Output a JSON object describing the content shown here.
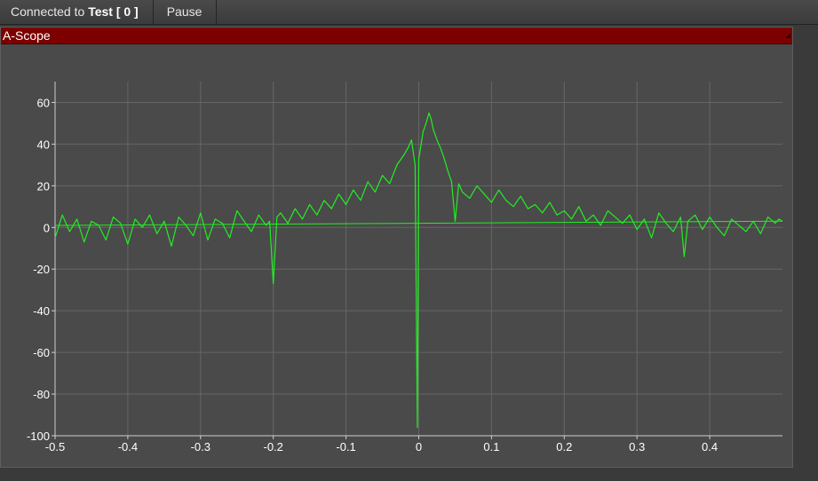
{
  "toolbar": {
    "connection_prefix": "Connected to",
    "connection_name": "Test [ 0 ]",
    "pause_label": "Pause"
  },
  "panel": {
    "title": "A-Scope"
  },
  "colors": {
    "trace": "#22ee22",
    "title_bar": "#7d0000",
    "plot_bg": "#4a4a4a",
    "grid": "#666666",
    "axis": "#cfcfcf"
  },
  "chart_data": {
    "type": "line",
    "title": "",
    "xlabel": "",
    "ylabel": "",
    "xlim": [
      -0.5,
      0.5
    ],
    "ylim": [
      -100,
      70
    ],
    "grid": true,
    "xticks": [
      -0.5,
      -0.4,
      -0.3,
      -0.2,
      -0.1,
      0,
      0.1,
      0.2,
      0.3,
      0.4
    ],
    "xtick_labels": [
      "-0.5",
      "-0.4",
      "-0.3",
      "-0.2",
      "-0.1",
      "0",
      "0.1",
      "0.2",
      "0.3",
      "0.4"
    ],
    "yticks": [
      60,
      40,
      20,
      0,
      -20,
      -40,
      -60,
      -80,
      -100
    ],
    "ytick_labels": [
      "60",
      "40",
      "20",
      "0",
      "-20",
      "-40",
      "-60",
      "-80",
      "-100"
    ],
    "series": [
      {
        "x": [
          -0.5,
          -0.49,
          -0.48,
          -0.47,
          -0.46,
          -0.45,
          -0.44,
          -0.43,
          -0.42,
          -0.41,
          -0.4,
          -0.39,
          -0.38,
          -0.37,
          -0.36,
          -0.35,
          -0.34,
          -0.33,
          -0.32,
          -0.31,
          -0.3,
          -0.29,
          -0.28,
          -0.27,
          -0.26,
          -0.25,
          -0.24,
          -0.23,
          -0.22,
          -0.21,
          -0.205,
          -0.2,
          -0.195,
          -0.19,
          -0.18,
          -0.17,
          -0.16,
          -0.15,
          -0.14,
          -0.13,
          -0.12,
          -0.11,
          -0.1,
          -0.09,
          -0.08,
          -0.07,
          -0.06,
          -0.05,
          -0.04,
          -0.03,
          -0.02,
          -0.015,
          -0.01,
          -0.005,
          -0.002,
          0,
          0.002,
          0.006,
          0.01,
          0.014,
          0.017,
          0.02,
          0.025,
          0.03,
          0.035,
          0.04,
          0.045,
          0.05,
          0.055,
          0.06,
          0.07,
          0.08,
          0.09,
          0.1,
          0.11,
          0.12,
          0.13,
          0.14,
          0.15,
          0.16,
          0.17,
          0.18,
          0.19,
          0.2,
          0.21,
          0.22,
          0.23,
          0.24,
          0.25,
          0.26,
          0.27,
          0.28,
          0.29,
          0.3,
          0.31,
          0.32,
          0.33,
          0.34,
          0.35,
          0.36,
          0.365,
          0.37,
          0.38,
          0.39,
          0.4,
          0.41,
          0.42,
          0.43,
          0.44,
          0.45,
          0.46,
          0.47,
          0.48,
          0.49,
          0.495,
          0.5
        ],
        "y": [
          -5,
          6,
          -2,
          4,
          -7,
          3,
          1,
          -6,
          5,
          2,
          -8,
          4,
          0,
          6,
          -3,
          3,
          -9,
          5,
          1,
          -4,
          7,
          -6,
          4,
          2,
          -5,
          8,
          3,
          -2,
          6,
          1,
          3,
          -27,
          5,
          7,
          2,
          9,
          4,
          11,
          6,
          13,
          9,
          16,
          11,
          18,
          13,
          22,
          17,
          25,
          21,
          30,
          35,
          38,
          42,
          30,
          -96,
          33,
          37,
          46,
          50,
          55,
          52,
          47,
          42,
          38,
          33,
          27,
          22,
          3,
          21,
          17,
          14,
          20,
          16,
          12,
          18,
          13,
          10,
          15,
          9,
          11,
          7,
          12,
          6,
          8,
          4,
          10,
          3,
          6,
          1,
          8,
          5,
          2,
          6,
          -1,
          4,
          -5,
          7,
          2,
          -2,
          5,
          -14,
          3,
          6,
          -1,
          5,
          0,
          -4,
          4,
          1,
          -2,
          3,
          -3,
          5,
          2,
          4,
          3
        ]
      }
    ],
    "baseline": {
      "from": [
        -0.5,
        1
      ],
      "to": [
        0.5,
        3
      ]
    }
  }
}
